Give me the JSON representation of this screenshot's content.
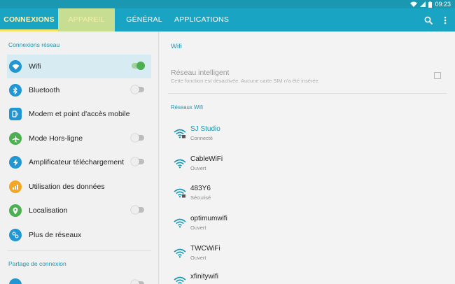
{
  "status": {
    "time": "09:23"
  },
  "tabs": [
    {
      "label": "CONNEXIONS"
    },
    {
      "label": "APPAREIL"
    },
    {
      "label": "GÉNÉRAL"
    },
    {
      "label": "APPLICATIONS"
    }
  ],
  "left": {
    "section1": "Connexions réseau",
    "items": [
      {
        "label": "Wifi",
        "icon": "wifi-icon",
        "toggle": "on"
      },
      {
        "label": "Bluetooth",
        "icon": "bluetooth-icon",
        "toggle": "off"
      },
      {
        "label": "Modem et point d'accès mobile",
        "icon": "tethering-icon"
      },
      {
        "label": "Mode Hors-ligne",
        "icon": "airplane-icon",
        "toggle": "off"
      },
      {
        "label": "Amplificateur téléchargement",
        "icon": "lightning-icon",
        "toggle": "off"
      },
      {
        "label": "Utilisation des données",
        "icon": "data-usage-icon"
      },
      {
        "label": "Localisation",
        "icon": "location-icon",
        "toggle": "off"
      },
      {
        "label": "Plus de réseaux",
        "icon": "more-networks-icon"
      }
    ],
    "section2": "Partage de connexion"
  },
  "right": {
    "title": "Wifi",
    "smart": {
      "title": "Réseau intelligent",
      "desc": "Cette fonction est désactivée. Aucune carte SIM n'a été insérée."
    },
    "networks_head": "Réseaux Wifi",
    "networks": [
      {
        "name": "SJ Studio",
        "status": "Connecté",
        "secured": true,
        "connected": true
      },
      {
        "name": "CableWiFi",
        "status": "Ouvert",
        "secured": false
      },
      {
        "name": "483Y6",
        "status": "Sécurisé",
        "secured": true
      },
      {
        "name": "optimumwifi",
        "status": "Ouvert",
        "secured": false
      },
      {
        "name": "TWCWiFi",
        "status": "Ouvert",
        "secured": false
      },
      {
        "name": "xfinitywifi",
        "status": "",
        "secured": false
      }
    ]
  },
  "colors": {
    "tabbar": "#1aa4c3",
    "statusbar": "#1a97b1",
    "accent": "#1a97b1",
    "active_tab_text": "#fff4b0",
    "toggle_on": "#4caf50"
  }
}
